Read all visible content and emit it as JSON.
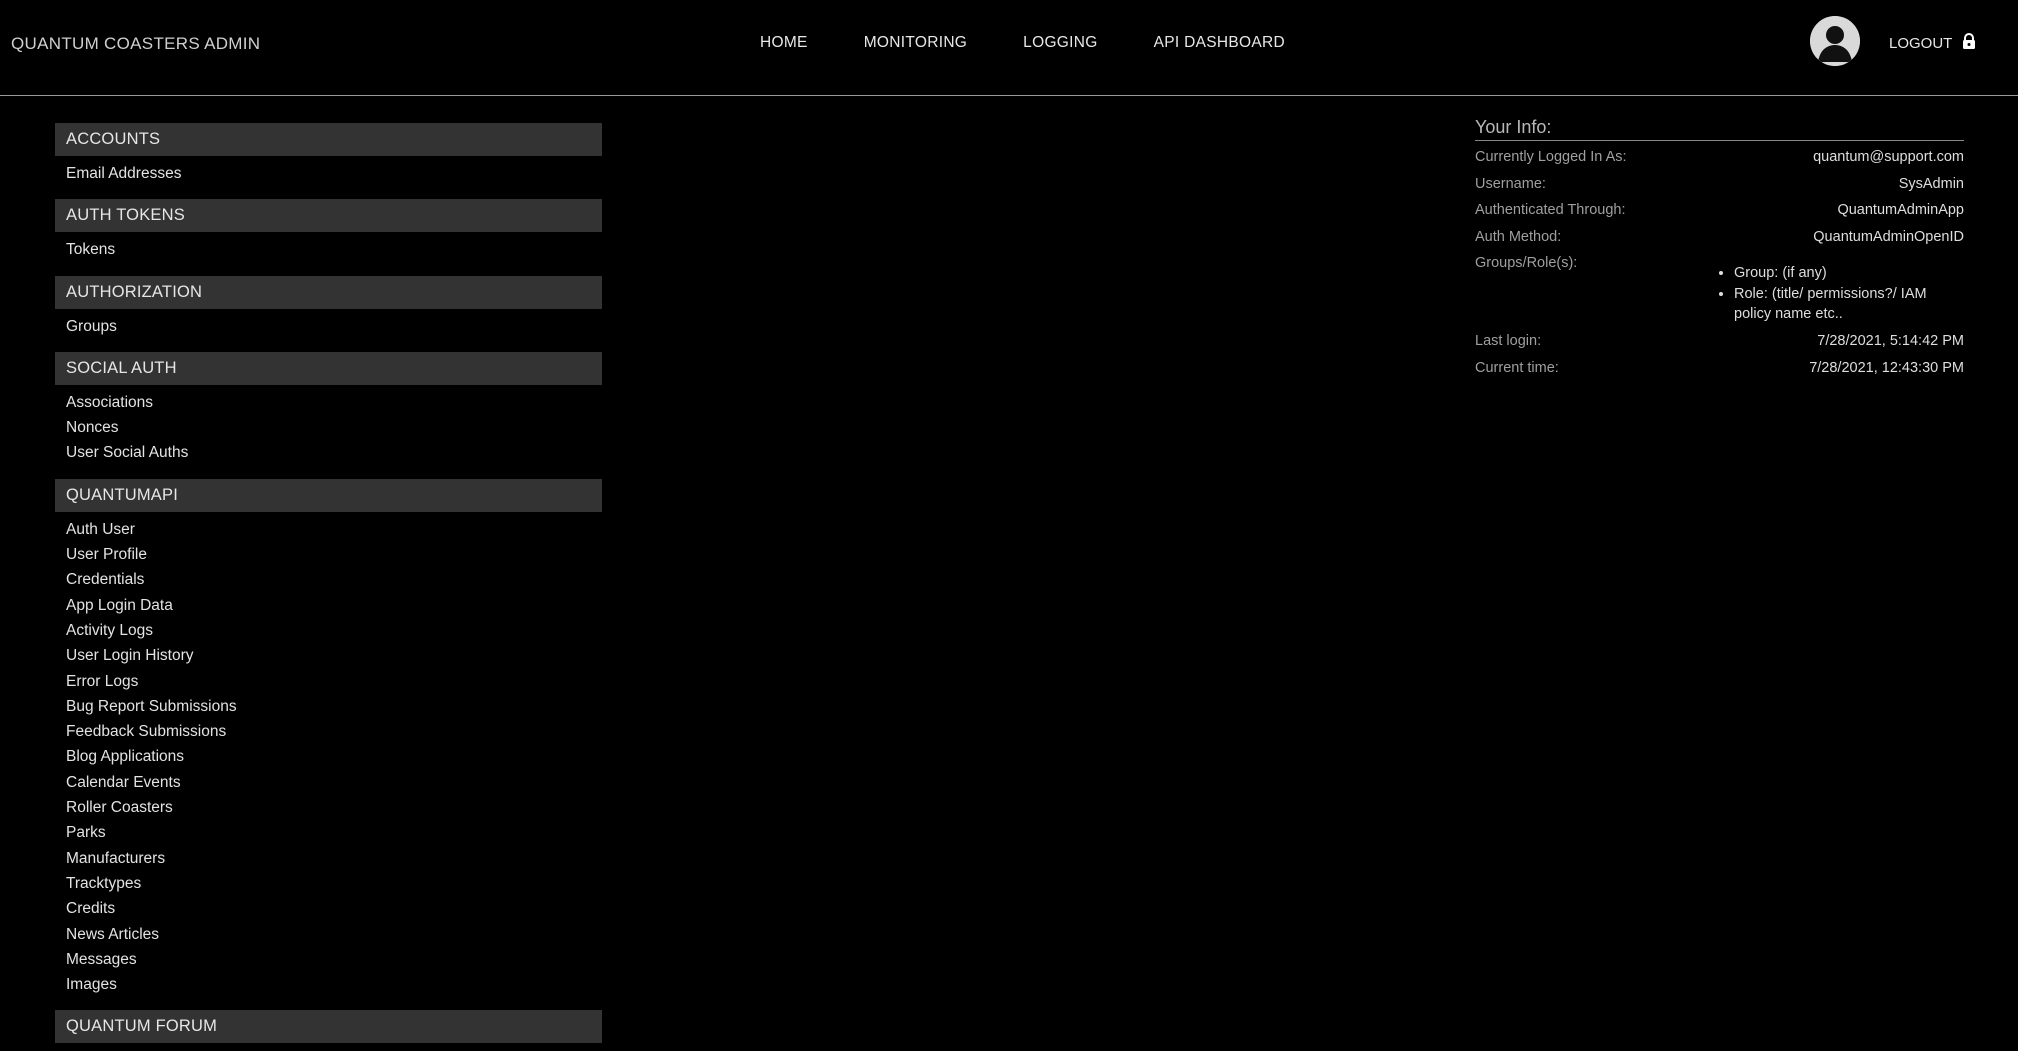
{
  "header": {
    "brand": "QUANTUM COASTERS ADMIN",
    "nav": [
      "HOME",
      "MONITORING",
      "LOGGING",
      "API DASHBOARD"
    ],
    "logout_label": "LOGOUT",
    "avatar_icon": "user-silhouette-icon",
    "lock_icon": "lock-icon"
  },
  "sidebar": {
    "sections": [
      {
        "title": "ACCOUNTS",
        "items": [
          "Email Addresses"
        ]
      },
      {
        "title": "AUTH TOKENS",
        "items": [
          "Tokens"
        ]
      },
      {
        "title": "AUTHORIZATION",
        "items": [
          "Groups"
        ]
      },
      {
        "title": "SOCIAL AUTH",
        "items": [
          "Associations",
          "Nonces",
          "User Social Auths"
        ]
      },
      {
        "title": "QUANTUMAPI",
        "items": [
          "Auth User",
          "User Profile",
          "Credentials",
          "App Login Data",
          "Activity Logs",
          "User Login History",
          "Error Logs",
          "Bug Report Submissions",
          "Feedback Submissions",
          "Blog Applications",
          "Calendar Events",
          "Roller Coasters",
          "Parks",
          "Manufacturers",
          "Tracktypes",
          "Credits",
          "News Articles",
          "Messages",
          "Images"
        ]
      },
      {
        "title": "QUANTUM FORUM",
        "items": []
      }
    ]
  },
  "info": {
    "title": "Your Info:",
    "logged_in_label": "Currently Logged In As:",
    "logged_in_value": "quantum@support.com",
    "username_label": "Username:",
    "username_value": "SysAdmin",
    "auth_through_label": "Authenticated Through:",
    "auth_through_value": "QuantumAdminApp",
    "auth_method_label": "Auth Method:",
    "auth_method_value": "QuantumAdminOpenID",
    "groups_label": "Groups/Role(s):",
    "groups": [
      "Group: (if any)",
      "Role: (title/ permissions?/ IAM policy name etc.."
    ],
    "last_login_label": "Last login:",
    "last_login_value": "7/28/2021, 5:14:42 PM",
    "current_time_label": "Current time:",
    "current_time_value": "7/28/2021, 12:43:30 PM"
  },
  "colors": {
    "background": "#000000",
    "section_header_bg": "#333333",
    "text": "#e6e6e6"
  }
}
